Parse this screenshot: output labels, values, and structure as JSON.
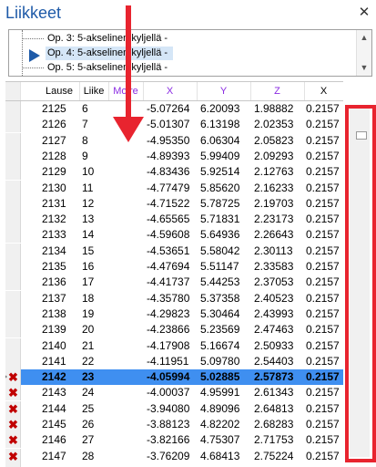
{
  "window": {
    "title": "Liikkeet",
    "close_glyph": "✕"
  },
  "tree": {
    "items": [
      {
        "label": "Op. 3: 5-akselinen kyljellä -",
        "selected": false
      },
      {
        "label": "Op. 4: 5-akselinen kyljellä -",
        "selected": true
      },
      {
        "label": "Op. 5: 5-akselinen kyljellä -",
        "selected": false
      }
    ],
    "scroll_up": "▲",
    "scroll_down": "▼"
  },
  "grid": {
    "columns": [
      "Lause",
      "Liike",
      "Moire",
      "X",
      "Y",
      "Z",
      "X"
    ],
    "rows": [
      {
        "lause": "2125",
        "liike": "6",
        "x": "-5.07264",
        "y": "6.20093",
        "z": "1.98882",
        "x2": "0.2157",
        "status": "none"
      },
      {
        "lause": "2126",
        "liike": "7",
        "x": "-5.01307",
        "y": "6.13198",
        "z": "2.02353",
        "x2": "0.2157",
        "status": "none"
      },
      {
        "lause": "2127",
        "liike": "8",
        "x": "-4.95350",
        "y": "6.06304",
        "z": "2.05823",
        "x2": "0.2157",
        "status": "none"
      },
      {
        "lause": "2128",
        "liike": "9",
        "x": "-4.89393",
        "y": "5.99409",
        "z": "2.09293",
        "x2": "0.2157",
        "status": "none"
      },
      {
        "lause": "2129",
        "liike": "10",
        "x": "-4.83436",
        "y": "5.92514",
        "z": "2.12763",
        "x2": "0.2157",
        "status": "none"
      },
      {
        "lause": "2130",
        "liike": "11",
        "x": "-4.77479",
        "y": "5.85620",
        "z": "2.16233",
        "x2": "0.2157",
        "status": "none"
      },
      {
        "lause": "2131",
        "liike": "12",
        "x": "-4.71522",
        "y": "5.78725",
        "z": "2.19703",
        "x2": "0.2157",
        "status": "none"
      },
      {
        "lause": "2132",
        "liike": "13",
        "x": "-4.65565",
        "y": "5.71831",
        "z": "2.23173",
        "x2": "0.2157",
        "status": "none"
      },
      {
        "lause": "2133",
        "liike": "14",
        "x": "-4.59608",
        "y": "5.64936",
        "z": "2.26643",
        "x2": "0.2157",
        "status": "none"
      },
      {
        "lause": "2134",
        "liike": "15",
        "x": "-4.53651",
        "y": "5.58042",
        "z": "2.30113",
        "x2": "0.2157",
        "status": "none"
      },
      {
        "lause": "2135",
        "liike": "16",
        "x": "-4.47694",
        "y": "5.51147",
        "z": "2.33583",
        "x2": "0.2157",
        "status": "none"
      },
      {
        "lause": "2136",
        "liike": "17",
        "x": "-4.41737",
        "y": "5.44253",
        "z": "2.37053",
        "x2": "0.2157",
        "status": "none"
      },
      {
        "lause": "2137",
        "liike": "18",
        "x": "-4.35780",
        "y": "5.37358",
        "z": "2.40523",
        "x2": "0.2157",
        "status": "none"
      },
      {
        "lause": "2138",
        "liike": "19",
        "x": "-4.29823",
        "y": "5.30464",
        "z": "2.43993",
        "x2": "0.2157",
        "status": "none"
      },
      {
        "lause": "2139",
        "liike": "20",
        "x": "-4.23866",
        "y": "5.23569",
        "z": "2.47463",
        "x2": "0.2157",
        "status": "none"
      },
      {
        "lause": "2140",
        "liike": "21",
        "x": "-4.17908",
        "y": "5.16674",
        "z": "2.50933",
        "x2": "0.2157",
        "status": "none"
      },
      {
        "lause": "2141",
        "liike": "22",
        "x": "-4.11951",
        "y": "5.09780",
        "z": "2.54403",
        "x2": "0.2157",
        "status": "none"
      },
      {
        "lause": "2142",
        "liike": "23",
        "x": "-4.05994",
        "y": "5.02885",
        "z": "2.57873",
        "x2": "0.2157",
        "status": "selected"
      },
      {
        "lause": "2143",
        "liike": "24",
        "x": "-4.00037",
        "y": "4.95991",
        "z": "2.61343",
        "x2": "0.2157",
        "status": "error"
      },
      {
        "lause": "2144",
        "liike": "25",
        "x": "-3.94080",
        "y": "4.89096",
        "z": "2.64813",
        "x2": "0.2157",
        "status": "error"
      },
      {
        "lause": "2145",
        "liike": "26",
        "x": "-3.88123",
        "y": "4.82202",
        "z": "2.68283",
        "x2": "0.2157",
        "status": "error"
      },
      {
        "lause": "2146",
        "liike": "27",
        "x": "-3.82166",
        "y": "4.75307",
        "z": "2.71753",
        "x2": "0.2157",
        "status": "error"
      },
      {
        "lause": "2147",
        "liike": "28",
        "x": "-3.76209",
        "y": "4.68413",
        "z": "2.75224",
        "x2": "0.2157",
        "status": "error"
      },
      {
        "lause": "2148",
        "liike": "29",
        "x": "-3.70252",
        "y": "4.61518",
        "z": "2.78694",
        "x2": "0.2157",
        "status": "error"
      }
    ],
    "error_glyph": "✖"
  },
  "colors": {
    "title": "#1e5aa8",
    "selection": "#3f8ff0",
    "annotation": "#e8242f",
    "error": "#c00000"
  }
}
